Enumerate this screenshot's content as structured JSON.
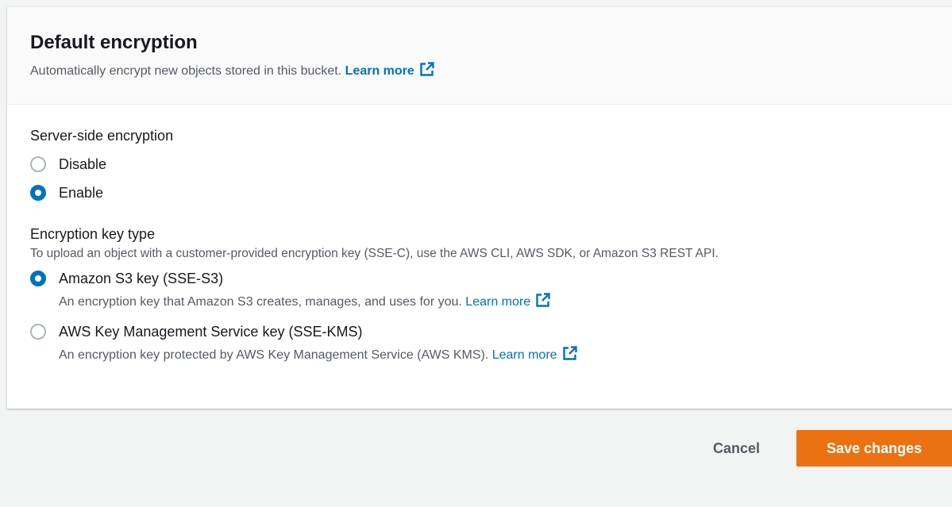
{
  "header": {
    "title": "Default encryption",
    "description": "Automatically encrypt new objects stored in this bucket.",
    "learn_more": "Learn more"
  },
  "sse": {
    "label": "Server-side encryption",
    "options": [
      {
        "label": "Disable",
        "checked": false
      },
      {
        "label": "Enable",
        "checked": true
      }
    ]
  },
  "key_type": {
    "label": "Encryption key type",
    "description": "To upload an object with a customer-provided encryption key (SSE-C), use the AWS CLI, AWS SDK, or Amazon S3 REST API.",
    "options": [
      {
        "label": "Amazon S3 key (SSE-S3)",
        "description": "An encryption key that Amazon S3 creates, manages, and uses for you.",
        "learn_more": "Learn more",
        "checked": true
      },
      {
        "label": "AWS Key Management Service key (SSE-KMS)",
        "description": "An encryption key protected by AWS Key Management Service (AWS KMS).",
        "learn_more": "Learn more",
        "checked": false
      }
    ]
  },
  "footer": {
    "cancel_label": "Cancel",
    "save_label": "Save changes"
  },
  "colors": {
    "accent": "#0073bb",
    "primary_button": "#ec7211",
    "background": "#f2f3f3"
  }
}
